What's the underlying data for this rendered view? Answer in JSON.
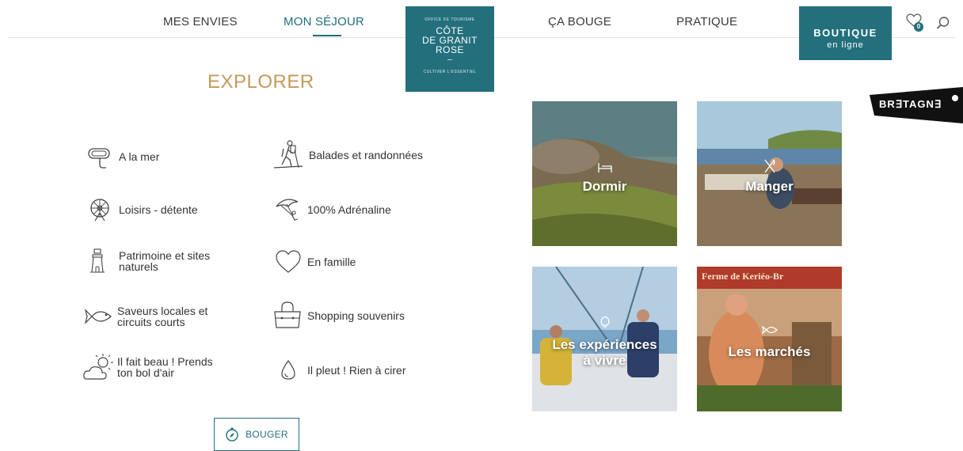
{
  "nav": {
    "items": [
      "MES ENVIES",
      "MON SÉJOUR",
      "ÇA BOUGE",
      "PRATIQUE"
    ],
    "active": "MON SÉJOUR"
  },
  "logo": {
    "top": "OFFICE DE TOURISME",
    "line1": "CÔTE",
    "line2": "DE GRANIT",
    "line3": "ROSE",
    "tagline": "CULTIVER L'ESSENTIEL"
  },
  "boutique": {
    "line1": "BOUTIQUE",
    "line2": "en ligne"
  },
  "favorites": {
    "count": "0"
  },
  "bretagne": {
    "label": "BR∃TAGN∃"
  },
  "section": {
    "title": "EXPLORER"
  },
  "categories": {
    "left": [
      {
        "label": "A la mer",
        "icon": "snorkel-mask-icon"
      },
      {
        "label": "Loisirs - détente",
        "icon": "ferris-wheel-icon"
      },
      {
        "label": "Patrimoine et sites\nnaturels",
        "icon": "lighthouse-icon"
      },
      {
        "label": "Saveurs locales et\ncircuits courts",
        "icon": "fish-icon"
      },
      {
        "label": "Il fait beau ! Prends\nton bol d'air",
        "icon": "sun-cloud-icon"
      }
    ],
    "right": [
      {
        "label": "Balades et randonnées",
        "icon": "hiker-icon"
      },
      {
        "label": "100% Adrénaline",
        "icon": "paraglider-icon"
      },
      {
        "label": "En famille",
        "icon": "heart-icon"
      },
      {
        "label": "Shopping souvenirs",
        "icon": "shopping-bag-icon"
      },
      {
        "label": "Il pleut ! Rien à cirer",
        "icon": "raindrop-icon"
      }
    ]
  },
  "tiles": [
    {
      "label": "Dormir",
      "icon": "bed-icon"
    },
    {
      "label": "Manger",
      "icon": "cutlery-icon"
    },
    {
      "label": "Les expériences\nà vivre",
      "icon": "bulb-icon"
    },
    {
      "label": "Les marchés",
      "icon": "fish-icon",
      "sign": "Ferme de Keriéo-Br"
    }
  ],
  "bouger": {
    "label": "BOUGER",
    "icon": "compass-icon"
  },
  "colors": {
    "brand": "#236f7c",
    "accent_gold": "#c39a5c"
  }
}
